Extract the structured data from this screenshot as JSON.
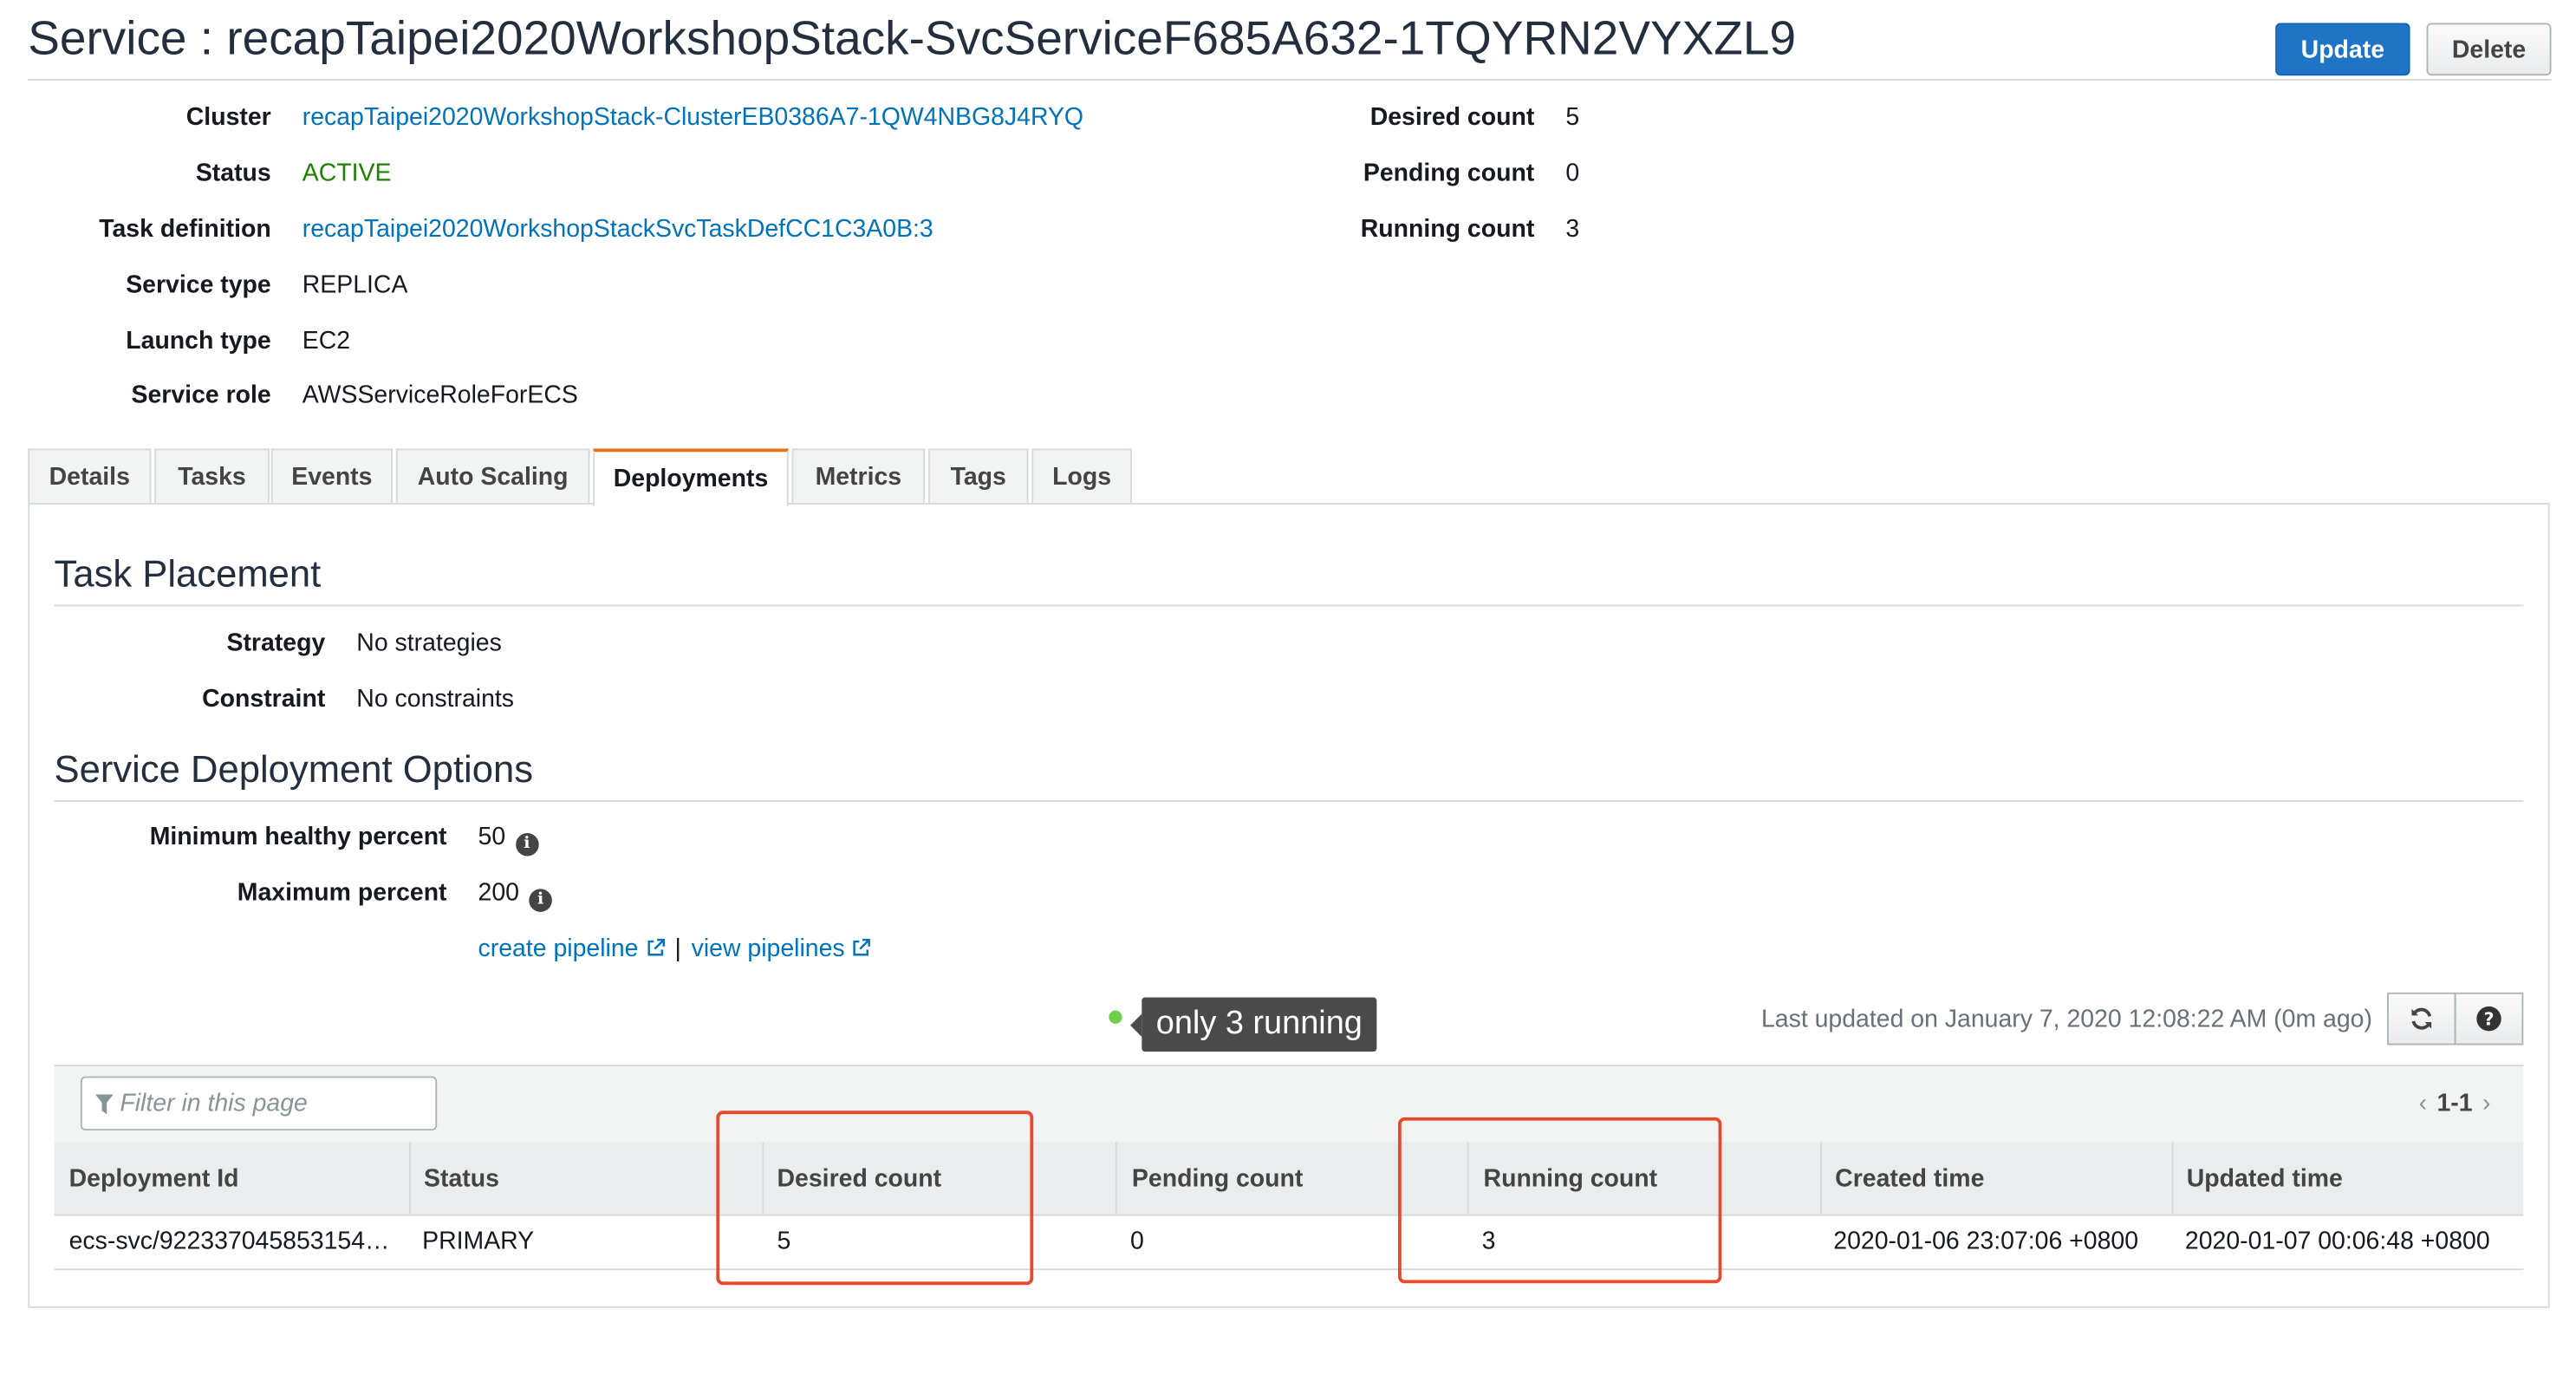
{
  "header": {
    "title": "Service : recapTaipei2020WorkshopStack-SvcServiceF685A632-1TQYRN2VYXZL9",
    "update_label": "Update",
    "delete_label": "Delete"
  },
  "details_left": [
    {
      "label": "Cluster",
      "value": "recapTaipei2020WorkshopStack-ClusterEB0386A7-1QW4NBG8J4RYQ"
    },
    {
      "label": "Status",
      "value": "ACTIVE"
    },
    {
      "label": "Task definition",
      "value": "recapTaipei2020WorkshopStackSvcTaskDefCC1C3A0B:3"
    },
    {
      "label": "Service type",
      "value": "REPLICA"
    },
    {
      "label": "Launch type",
      "value": "EC2"
    },
    {
      "label": "Service role",
      "value": "AWSServiceRoleForECS"
    }
  ],
  "details_right": [
    {
      "label": "Desired count",
      "value": "5"
    },
    {
      "label": "Pending count",
      "value": "0"
    },
    {
      "label": "Running count",
      "value": "3"
    }
  ],
  "tabs": [
    {
      "label": "Details"
    },
    {
      "label": "Tasks"
    },
    {
      "label": "Events"
    },
    {
      "label": "Auto Scaling"
    },
    {
      "label": "Deployments"
    },
    {
      "label": "Metrics"
    },
    {
      "label": "Tags"
    },
    {
      "label": "Logs"
    }
  ],
  "task_placement": {
    "title": "Task Placement",
    "strategy_label": "Strategy",
    "strategy_value": "No strategies",
    "constraint_label": "Constraint",
    "constraint_value": "No constraints"
  },
  "deployment_options": {
    "title": "Service Deployment Options",
    "min_label": "Minimum healthy percent",
    "min_value": "50",
    "max_label": "Maximum percent",
    "max_value": "200",
    "create_pipeline": "create pipeline",
    "separator": "|",
    "view_pipelines": "view pipelines"
  },
  "tooltip": {
    "text": "only 3 running"
  },
  "last_updated": "Last updated on January 7, 2020 12:08:22 AM (0m ago)",
  "table": {
    "filter_placeholder": "Filter in this page",
    "pager": "1-1",
    "columns": [
      "Deployment Id",
      "Status",
      "Desired count",
      "Pending count",
      "Running count",
      "Created time",
      "Updated time"
    ],
    "rows": [
      [
        "ecs-svc/922337045853154…",
        "PRIMARY",
        "5",
        "0",
        "3",
        "2020-01-06 23:07:06 +0800",
        "2020-01-07 00:06:48 +0800"
      ]
    ]
  },
  "colors": {
    "accent": "#0073bb",
    "primary_button": "#1f74c6",
    "active_status": "#1d8102",
    "tab_highlight": "#ec7211",
    "annotation_box": "#e8482c"
  }
}
